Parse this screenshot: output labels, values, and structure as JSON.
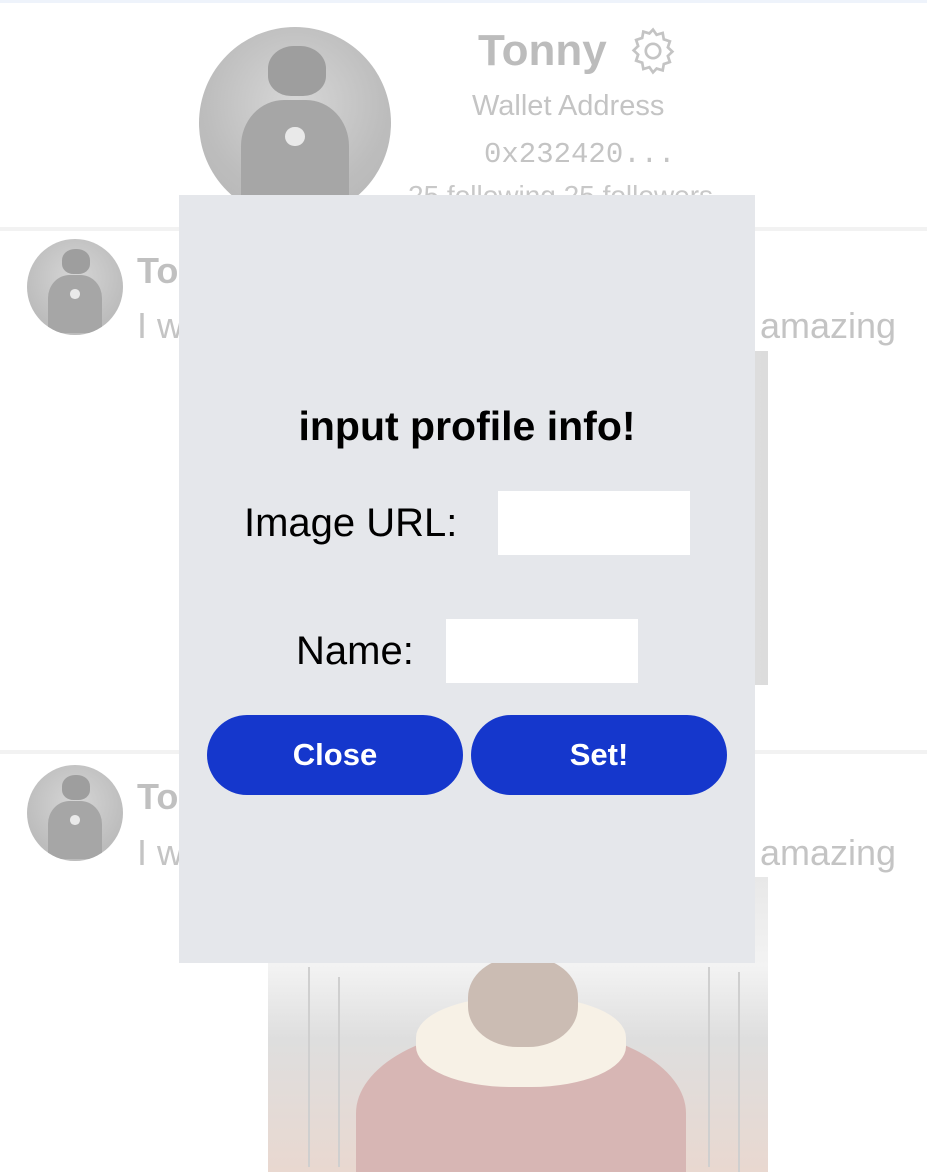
{
  "profile": {
    "name": "Tonny",
    "wallet_label": "Wallet Address",
    "wallet_value": "0x232420...",
    "follows": "25 following  25 followers"
  },
  "posts": [
    {
      "name": "Tonny",
      "text": "I w",
      "text_tail": "amazing"
    },
    {
      "name": "Tonny",
      "text": "I w",
      "text_tail": "amazing"
    }
  ],
  "modal": {
    "title": "input profile info!",
    "image_url_label": "Image URL:",
    "image_url_value": "",
    "name_label": "Name:",
    "name_value": "",
    "close_label": "Close",
    "set_label": "Set!"
  },
  "colors": {
    "modal_bg": "#e5e7eb",
    "button_bg": "#1537cc",
    "button_text": "#ffffff"
  },
  "icons": [
    "settings-gear-icon"
  ]
}
